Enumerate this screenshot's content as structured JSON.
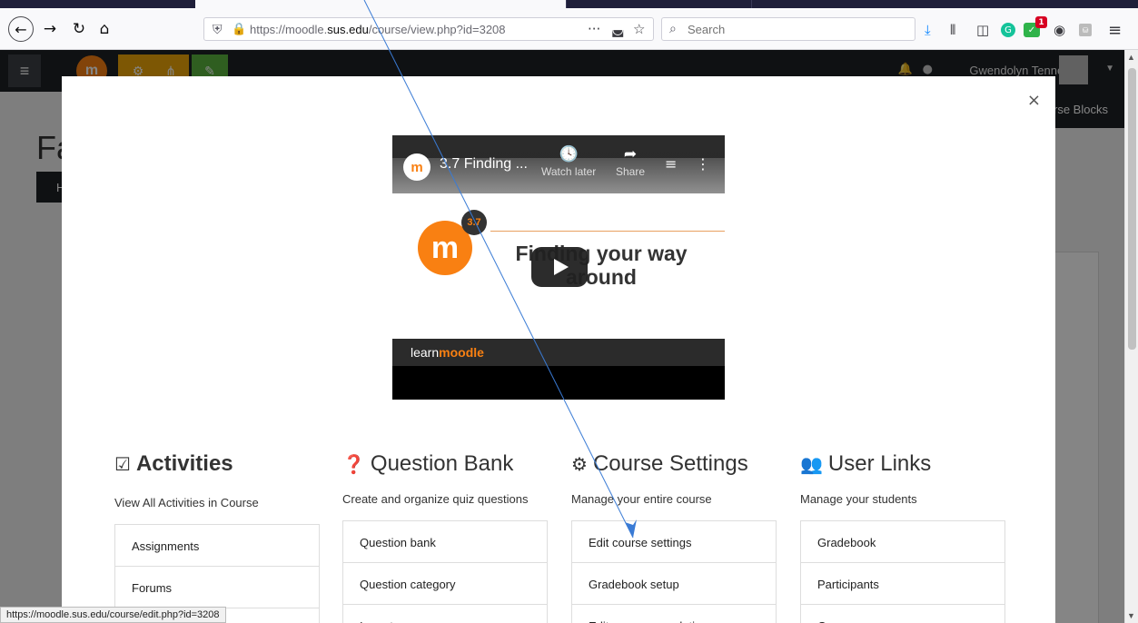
{
  "browser": {
    "url_prefix": "https://moodle.",
    "url_domain": "sus.edu",
    "url_path": "/course/view.php?id=3208",
    "search_placeholder": "Search",
    "back_glyph": "←",
    "forward_glyph": "→",
    "reload_glyph": "↻",
    "home_glyph": "⌂",
    "page_actions_glyph": "···",
    "pocket_glyph": "◛",
    "bookmark_glyph": "☆",
    "download_glyph": "⤓",
    "library_glyph": "⫴",
    "sidebar_glyph": "◫",
    "menu_glyph": "≡",
    "addon_badge": "1",
    "status_url": "https://moodle.sus.edu/course/edit.php?id=3208"
  },
  "moodle": {
    "username": "Gwendolyn Tennell",
    "course_title_visible": "Fa",
    "home_btn_visible": "H",
    "blocks_btn_visible": "rse Blocks",
    "logo_letter": "m"
  },
  "video": {
    "title": "3.7 Finding ...",
    "watch_later": "Watch later",
    "share": "Share",
    "badge": "3.7",
    "slide_text": "Finding your way around",
    "brand_learn": "learn",
    "brand_moodle": "moodle"
  },
  "modal": {
    "close_glyph": "×"
  },
  "columns": [
    {
      "title": "Activities",
      "icon": "☑",
      "description": "View All Activities in Course",
      "items": [
        "Assignments",
        "Forums",
        ""
      ]
    },
    {
      "title": "Question Bank",
      "icon": "❓",
      "description": "Create and organize quiz questions",
      "items": [
        "Question bank",
        "Question category",
        "Import"
      ]
    },
    {
      "title": "Course Settings",
      "icon": "⚙",
      "description": "Manage your entire course",
      "items": [
        "Edit course settings",
        "Gradebook setup",
        "Edit course completion"
      ]
    },
    {
      "title": "User Links",
      "icon": "👥",
      "description": "Manage your students",
      "items": [
        "Gradebook",
        "Participants",
        "Groups"
      ]
    }
  ],
  "colors": {
    "moodle_orange": "#f98012",
    "navbar": "#1d2125",
    "pointer_line": "#3a7bd5"
  }
}
